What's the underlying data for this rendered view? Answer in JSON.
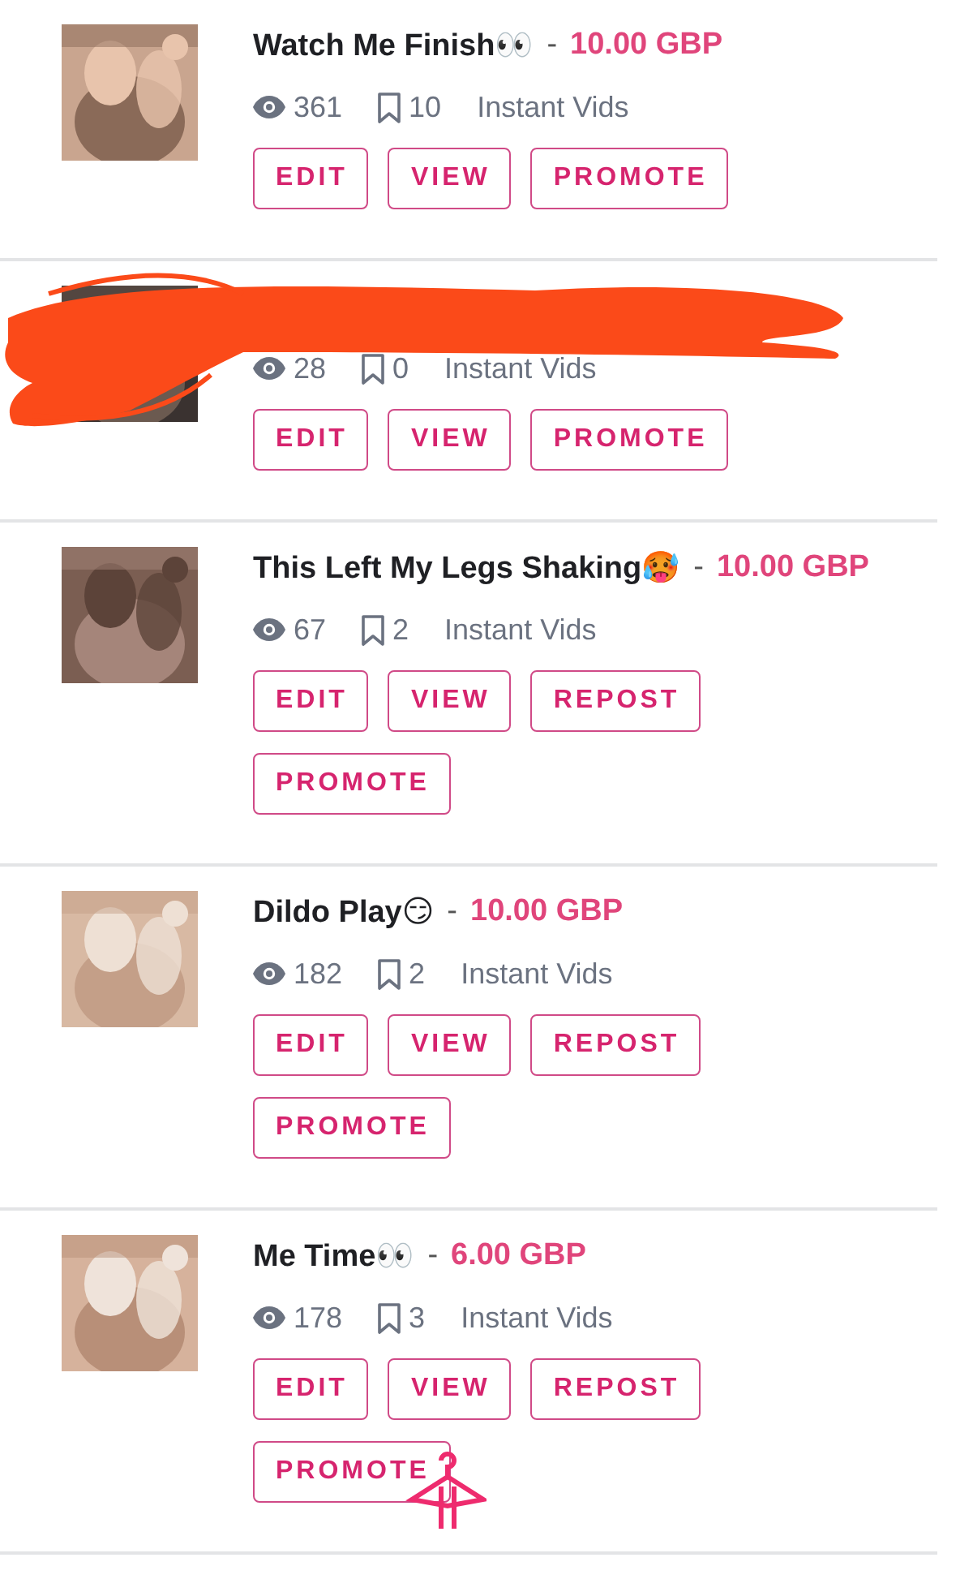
{
  "items": [
    {
      "title": "Watch Me Finish👀",
      "separator": "-",
      "price": "10.00 GBP",
      "views": "361",
      "saves": "10",
      "category": "Instant Vids",
      "redacted": false,
      "sticker": false,
      "buttons": [
        {
          "label": "EDIT"
        },
        {
          "label": "VIEW"
        },
        {
          "label": "PROMOTE"
        }
      ]
    },
    {
      "views": "28",
      "saves": "0",
      "category": "Instant Vids",
      "redacted": true,
      "sticker": false,
      "buttons": [
        {
          "label": "EDIT"
        },
        {
          "label": "VIEW"
        },
        {
          "label": "PROMOTE"
        }
      ]
    },
    {
      "title": "This Left My Legs Shaking🥵",
      "separator": "-",
      "price": "10.00 GBP",
      "views": "67",
      "saves": "2",
      "category": "Instant Vids",
      "redacted": false,
      "sticker": false,
      "buttons": [
        {
          "label": "EDIT"
        },
        {
          "label": "VIEW"
        },
        {
          "label": "REPOST"
        },
        {
          "label": "PROMOTE"
        }
      ]
    },
    {
      "title": "Dildo Play😏",
      "separator": "-",
      "price": "10.00 GBP",
      "views": "182",
      "saves": "2",
      "category": "Instant Vids",
      "redacted": false,
      "sticker": false,
      "buttons": [
        {
          "label": "EDIT"
        },
        {
          "label": "VIEW"
        },
        {
          "label": "REPOST"
        },
        {
          "label": "PROMOTE"
        }
      ]
    },
    {
      "title": "Me Time👀",
      "separator": "-",
      "price": "6.00 GBP",
      "views": "178",
      "saves": "3",
      "category": "Instant Vids",
      "redacted": false,
      "sticker": true,
      "buttons": [
        {
          "label": "EDIT"
        },
        {
          "label": "VIEW"
        },
        {
          "label": "REPOST"
        },
        {
          "label": "PROMOTE"
        }
      ]
    }
  ]
}
